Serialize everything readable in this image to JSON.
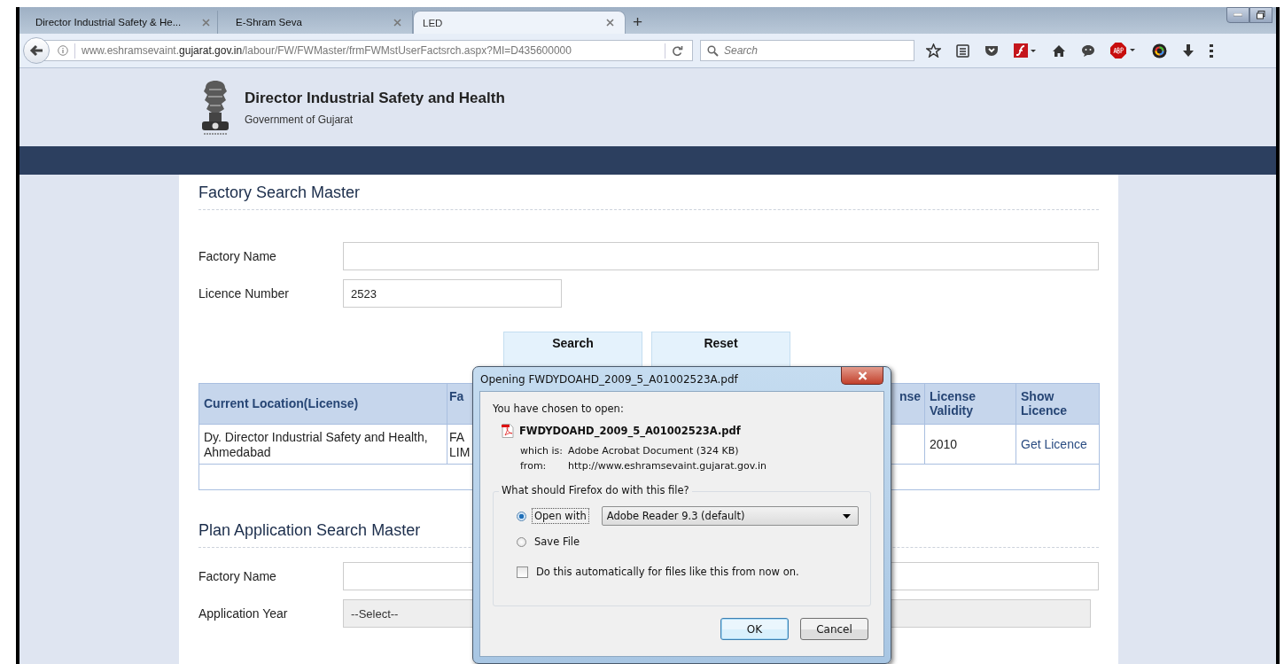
{
  "browser": {
    "tabs": [
      {
        "title": "Director Industrial Safety & He...",
        "selected": false
      },
      {
        "title": "E-Shram Seva",
        "selected": false
      },
      {
        "title": "LED",
        "selected": true
      }
    ],
    "new_tab": "+",
    "url": {
      "prefix": "www.eshramsevaint.",
      "domain": "gujarat.gov.in",
      "path": "/labour/FW/FWMaster/frmFWMstUserFactsrch.aspx?MI=D435600000"
    },
    "search": {
      "placeholder": "Search"
    }
  },
  "header": {
    "title": "Director Industrial Safety and Health",
    "subtitle": "Government of Gujarat"
  },
  "factory_search": {
    "title": "Factory Search Master",
    "fields": [
      {
        "label": "Factory Name",
        "kind": "wide"
      },
      {
        "label": "Licence Number",
        "value": "2523",
        "kind": "short"
      }
    ],
    "buttons": [
      "Search",
      "Reset"
    ],
    "table": {
      "columns": [
        "Current Location(License)",
        "Fa",
        "nse",
        "License Validity",
        "Show Licence"
      ],
      "rows": [
        {
          "cells": [
            "Dy. Director Industrial Safety and Health, Ahmedabad",
            "FA\nLIM",
            "",
            "2010"
          ],
          "link": "Get Licence"
        }
      ]
    }
  },
  "plan_search": {
    "title": "Plan Application Search Master",
    "fields": [
      {
        "label": "Factory Name",
        "kind": "wide"
      },
      {
        "label": "Application Year",
        "value": "--Select--",
        "kind": "select"
      }
    ]
  },
  "dialog": {
    "title": "Opening FWDYDOAHD_2009_5_A01002523A.pdf",
    "intro": "You have chosen to open:",
    "filename": "FWDYDOAHD_2009_5_A01002523A.pdf",
    "details": [
      {
        "label": "which is:",
        "value": "Adobe Acrobat Document (324 KB)"
      },
      {
        "label": "from:",
        "value": "http://www.eshramsevaint.gujarat.gov.in"
      }
    ],
    "question": "What should Firefox do with this file?",
    "options": [
      {
        "label": "Open with",
        "selected": true,
        "app": "Adobe Reader 9.3 (default)"
      },
      {
        "label": "Save File",
        "selected": false
      }
    ],
    "remember": {
      "label": "Do this automatically for files like this from now on.",
      "checked": false
    },
    "buttons": [
      "OK",
      "Cancel"
    ]
  }
}
